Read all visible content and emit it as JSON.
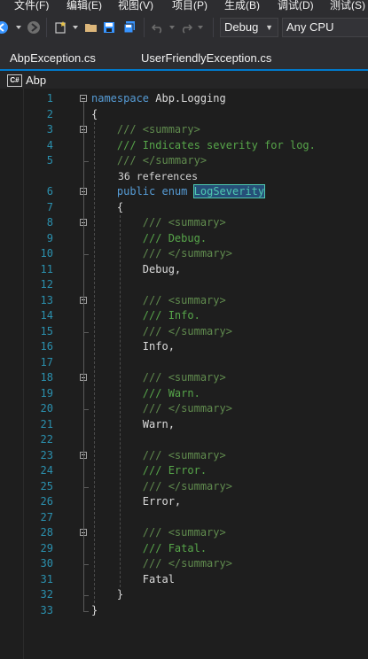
{
  "menu": {
    "items": [
      "文件(F)",
      "编辑(E)",
      "视图(V)",
      "项目(P)",
      "生成(B)",
      "调试(D)",
      "测试(S)"
    ]
  },
  "toolbar": {
    "configuration": "Debug",
    "platform": "Any CPU"
  },
  "tabs": {
    "items": [
      "AbpException.cs",
      "UserFriendlyException.cs"
    ]
  },
  "navigation": {
    "project": "Abp",
    "badge": "C#"
  },
  "editor": {
    "references_label": "36 references",
    "lines": [
      {
        "n": "1",
        "segments": [
          {
            "c": "kw",
            "t": "namespace"
          },
          {
            "c": "",
            "t": " Abp.Logging"
          }
        ]
      },
      {
        "n": "2",
        "segments": [
          {
            "c": "",
            "t": "{"
          }
        ]
      },
      {
        "n": "3",
        "segments": [
          {
            "c": "",
            "t": "    "
          },
          {
            "c": "cm-tag",
            "t": "/// <summary>"
          }
        ]
      },
      {
        "n": "4",
        "segments": [
          {
            "c": "",
            "t": "    "
          },
          {
            "c": "cm",
            "t": "/// Indicates severity for log."
          }
        ]
      },
      {
        "n": "5",
        "segments": [
          {
            "c": "",
            "t": "    "
          },
          {
            "c": "cm-tag",
            "t": "/// </summary>"
          }
        ]
      },
      {
        "n": "6",
        "segments": [
          {
            "c": "",
            "t": "    "
          },
          {
            "c": "kw",
            "t": "public"
          },
          {
            "c": "",
            "t": " "
          },
          {
            "c": "kw",
            "t": "enum"
          },
          {
            "c": "",
            "t": " "
          },
          {
            "c": "hl",
            "t": "LogSeverity"
          }
        ]
      },
      {
        "n": "7",
        "segments": [
          {
            "c": "",
            "t": "    {"
          }
        ]
      },
      {
        "n": "8",
        "segments": [
          {
            "c": "",
            "t": "        "
          },
          {
            "c": "cm-tag",
            "t": "/// <summary>"
          }
        ]
      },
      {
        "n": "9",
        "segments": [
          {
            "c": "",
            "t": "        "
          },
          {
            "c": "cm",
            "t": "/// Debug."
          }
        ]
      },
      {
        "n": "10",
        "segments": [
          {
            "c": "",
            "t": "        "
          },
          {
            "c": "cm-tag",
            "t": "/// </summary>"
          }
        ]
      },
      {
        "n": "11",
        "segments": [
          {
            "c": "",
            "t": "        Debug,"
          }
        ]
      },
      {
        "n": "12",
        "segments": [
          {
            "c": "",
            "t": ""
          }
        ]
      },
      {
        "n": "13",
        "segments": [
          {
            "c": "",
            "t": "        "
          },
          {
            "c": "cm-tag",
            "t": "/// <summary>"
          }
        ]
      },
      {
        "n": "14",
        "segments": [
          {
            "c": "",
            "t": "        "
          },
          {
            "c": "cm",
            "t": "/// Info."
          }
        ]
      },
      {
        "n": "15",
        "segments": [
          {
            "c": "",
            "t": "        "
          },
          {
            "c": "cm-tag",
            "t": "/// </summary>"
          }
        ]
      },
      {
        "n": "16",
        "segments": [
          {
            "c": "",
            "t": "        Info,"
          }
        ]
      },
      {
        "n": "17",
        "segments": [
          {
            "c": "",
            "t": ""
          }
        ]
      },
      {
        "n": "18",
        "segments": [
          {
            "c": "",
            "t": "        "
          },
          {
            "c": "cm-tag",
            "t": "/// <summary>"
          }
        ]
      },
      {
        "n": "19",
        "segments": [
          {
            "c": "",
            "t": "        "
          },
          {
            "c": "cm",
            "t": "/// Warn."
          }
        ]
      },
      {
        "n": "20",
        "segments": [
          {
            "c": "",
            "t": "        "
          },
          {
            "c": "cm-tag",
            "t": "/// </summary>"
          }
        ]
      },
      {
        "n": "21",
        "segments": [
          {
            "c": "",
            "t": "        Warn,"
          }
        ]
      },
      {
        "n": "22",
        "segments": [
          {
            "c": "",
            "t": ""
          }
        ]
      },
      {
        "n": "23",
        "segments": [
          {
            "c": "",
            "t": "        "
          },
          {
            "c": "cm-tag",
            "t": "/// <summary>"
          }
        ]
      },
      {
        "n": "24",
        "segments": [
          {
            "c": "",
            "t": "        "
          },
          {
            "c": "cm",
            "t": "/// Error."
          }
        ]
      },
      {
        "n": "25",
        "segments": [
          {
            "c": "",
            "t": "        "
          },
          {
            "c": "cm-tag",
            "t": "/// </summary>"
          }
        ]
      },
      {
        "n": "26",
        "segments": [
          {
            "c": "",
            "t": "        Error,"
          }
        ]
      },
      {
        "n": "27",
        "segments": [
          {
            "c": "",
            "t": ""
          }
        ]
      },
      {
        "n": "28",
        "segments": [
          {
            "c": "",
            "t": "        "
          },
          {
            "c": "cm-tag",
            "t": "/// <summary>"
          }
        ]
      },
      {
        "n": "29",
        "segments": [
          {
            "c": "",
            "t": "        "
          },
          {
            "c": "cm",
            "t": "/// Fatal."
          }
        ]
      },
      {
        "n": "30",
        "segments": [
          {
            "c": "",
            "t": "        "
          },
          {
            "c": "cm-tag",
            "t": "/// </summary>"
          }
        ]
      },
      {
        "n": "31",
        "segments": [
          {
            "c": "",
            "t": "        Fatal"
          }
        ]
      },
      {
        "n": "32",
        "segments": [
          {
            "c": "",
            "t": "    }"
          }
        ]
      },
      {
        "n": "33",
        "segments": [
          {
            "c": "",
            "t": "}"
          }
        ]
      }
    ]
  },
  "colors": {
    "keyword": "#569cd6",
    "comment": "#57a64a",
    "type": "#4ec9b0",
    "line_number": "#2b91af",
    "accent": "#007acc"
  }
}
